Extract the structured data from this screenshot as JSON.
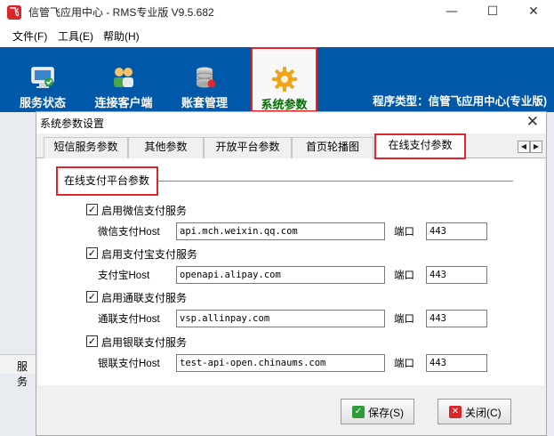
{
  "window": {
    "title": "信管飞应用中心 - RMS专业版 V9.5.682",
    "logo_text": "飞",
    "minimize": "—",
    "maximize": "☐",
    "close": "✕"
  },
  "menu": [
    "文件(F)",
    "工具(E)",
    "帮助(H)"
  ],
  "toolbar": {
    "items": [
      {
        "label": "服务状态",
        "icon": "monitor-icon"
      },
      {
        "label": "连接客户端",
        "icon": "users-icon"
      },
      {
        "label": "账套管理",
        "icon": "database-icon"
      },
      {
        "label": "系统参数",
        "icon": "gear-icon",
        "active": true
      }
    ],
    "program_type": "程序类型：信管飞应用中心(专业版)"
  },
  "background": {
    "bottom_label": "服务"
  },
  "dialog": {
    "title": "系统参数设置",
    "close": "✕",
    "tabs": [
      "短信服务参数",
      "其他参数",
      "开放平台参数",
      "首页轮播图",
      "在线支付参数"
    ],
    "active_tab": "在线支付参数",
    "scroll_left": "◀",
    "scroll_right": "▶",
    "group_title": "在线支付平台参数",
    "payments": [
      {
        "enable_label": "启用微信支付服务",
        "checked": true,
        "host_label": "微信支付Host",
        "host": "api.mch.weixin.qq.com",
        "port_label": "端口",
        "port": "443"
      },
      {
        "enable_label": "启用支付宝支付服务",
        "checked": true,
        "host_label": "支付宝Host",
        "host": "openapi.alipay.com",
        "port_label": "端口",
        "port": "443"
      },
      {
        "enable_label": "启用通联支付服务",
        "checked": true,
        "host_label": "通联支付Host",
        "host": "vsp.allinpay.com",
        "port_label": "端口",
        "port": "443"
      },
      {
        "enable_label": "启用银联支付服务",
        "checked": true,
        "host_label": "银联支付Host",
        "host": "test-api-open.chinaums.com",
        "port_label": "端口",
        "port": "443"
      }
    ],
    "save_label": "保存(S)",
    "close_label": "关闭(C)"
  },
  "colors": {
    "toolbar_blue": "#0058a8",
    "highlight_red": "#e0262d",
    "active_green": "#007000"
  }
}
